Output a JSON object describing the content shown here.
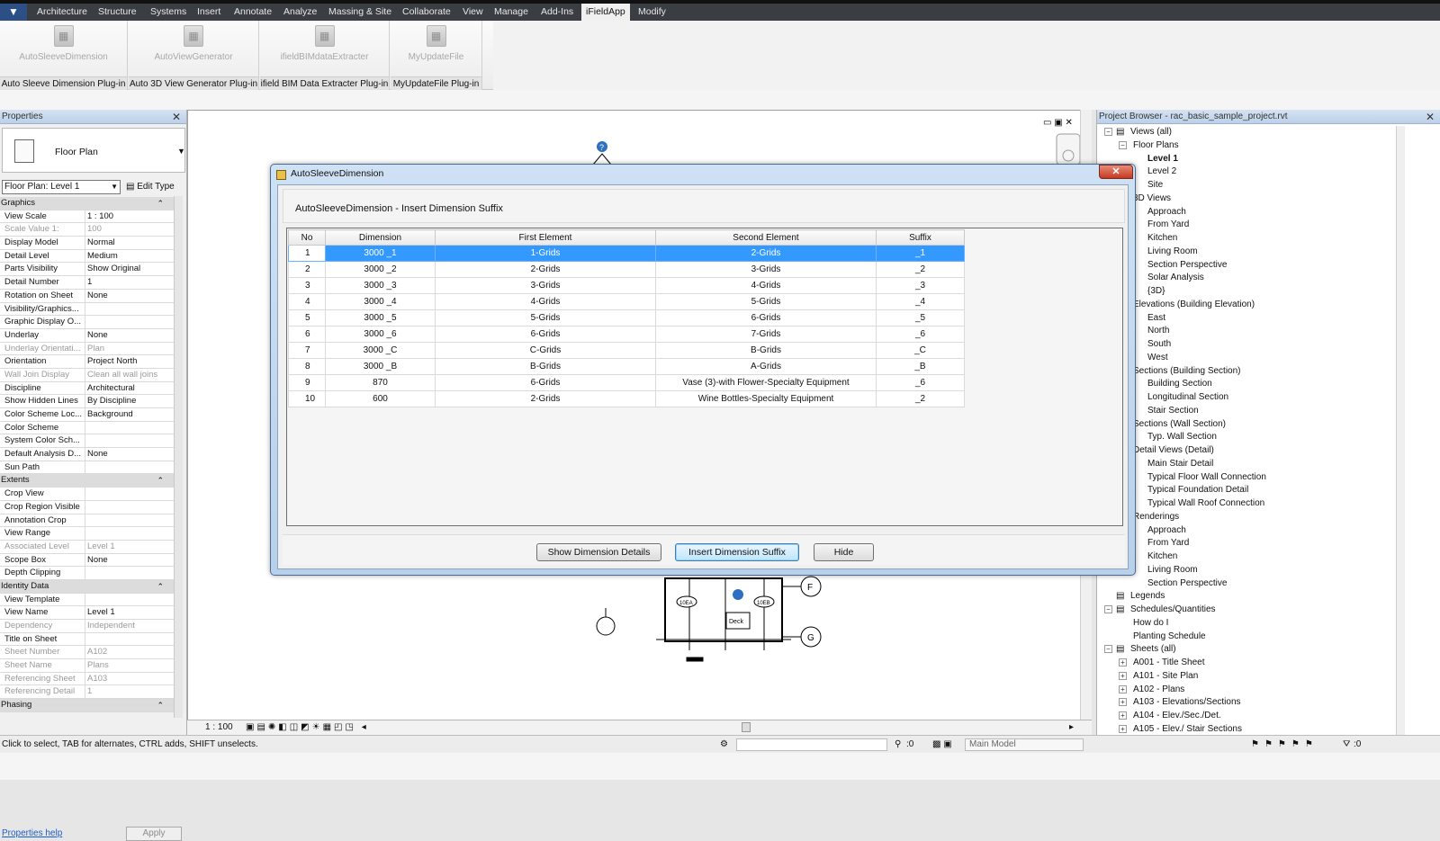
{
  "menubar": {
    "tabs": [
      "Architecture",
      "Structure",
      "Systems",
      "Insert",
      "Annotate",
      "Analyze",
      "Massing & Site",
      "Collaborate",
      "View",
      "Manage",
      "Add-Ins",
      "iFieldApp",
      "Modify"
    ],
    "active": "iFieldApp"
  },
  "ribbon": {
    "panels": [
      {
        "button": "AutoSleeveDimension",
        "title": "Auto Sleeve Dimension Plug-in"
      },
      {
        "button": "AutoViewGenerator",
        "title": "Auto 3D View Generator Plug-in"
      },
      {
        "button": "ifieldBIMdataExtracter",
        "title": "ifield BIM Data Extracter Plug-in"
      },
      {
        "button": "MyUpdateFile",
        "title": "MyUpdateFile Plug-in"
      }
    ]
  },
  "properties": {
    "title": "Properties",
    "type_name": "Floor Plan",
    "instance": "Floor Plan: Level 1",
    "edit_type": "Edit Type",
    "rows": [
      {
        "group": "Graphics"
      },
      {
        "name": "View Scale",
        "value": "1 : 100"
      },
      {
        "name": "Scale Value    1:",
        "value": "100",
        "dim": true
      },
      {
        "name": "Display Model",
        "value": "Normal"
      },
      {
        "name": "Detail Level",
        "value": "Medium"
      },
      {
        "name": "Parts Visibility",
        "value": "Show Original"
      },
      {
        "name": "Detail Number",
        "value": "1"
      },
      {
        "name": "Rotation on Sheet",
        "value": "None"
      },
      {
        "name": "Visibility/Graphics...",
        "button": "Edit..."
      },
      {
        "name": "Graphic Display O...",
        "button": "Edit..."
      },
      {
        "name": "Underlay",
        "value": "None"
      },
      {
        "name": "Underlay Orientati...",
        "value": "Plan",
        "dim": true
      },
      {
        "name": "Orientation",
        "value": "Project North"
      },
      {
        "name": "Wall Join Display",
        "value": "Clean all wall joins",
        "dim": true
      },
      {
        "name": "Discipline",
        "value": "Architectural"
      },
      {
        "name": "Show Hidden Lines",
        "value": "By Discipline"
      },
      {
        "name": "Color Scheme Loc...",
        "value": "Background"
      },
      {
        "name": "Color Scheme",
        "button": "Name"
      },
      {
        "name": "System Color Sch...",
        "button": "Edit..."
      },
      {
        "name": "Default Analysis D...",
        "value": "None"
      },
      {
        "name": "Sun Path",
        "check": "",
        "checkbox": true
      },
      {
        "group": "Extents"
      },
      {
        "name": "Crop View",
        "check": "✓",
        "checkbox": true
      },
      {
        "name": "Crop Region Visible",
        "check": "",
        "checkbox": true
      },
      {
        "name": "Annotation Crop",
        "check": "",
        "checkbox": true
      },
      {
        "name": "View Range",
        "button": "Edit..."
      },
      {
        "name": "Associated Level",
        "value": "Level 1",
        "dim": true
      },
      {
        "name": "Scope Box",
        "value": "None"
      },
      {
        "name": "Depth Clipping",
        "button": "No clip"
      },
      {
        "group": "Identity Data"
      },
      {
        "name": "View Template",
        "button": "<None>"
      },
      {
        "name": "View Name",
        "value": "Level 1"
      },
      {
        "name": "Dependency",
        "value": "Independent",
        "dim": true
      },
      {
        "name": "Title on Sheet",
        "value": ""
      },
      {
        "name": "Sheet Number",
        "value": "A102",
        "dim": true
      },
      {
        "name": "Sheet Name",
        "value": "Plans",
        "dim": true
      },
      {
        "name": "Referencing Sheet",
        "value": "A103",
        "dim": true
      },
      {
        "name": "Referencing Detail",
        "value": "1",
        "dim": true
      },
      {
        "group": "Phasing"
      }
    ],
    "help": "Properties help",
    "apply": "Apply"
  },
  "view_control": {
    "scale": "1 : 100"
  },
  "canvas": {
    "tags": [
      "F",
      "G"
    ],
    "deck": "Deck",
    "tag_a": "10EA",
    "tag_b": "10EB"
  },
  "browser": {
    "title": "Project Browser - rac_basic_sample_project.rvt",
    "nodes": [
      {
        "t": "Views (all)",
        "x": 37,
        "box": "−",
        "icon": true
      },
      {
        "t": "Floor Plans",
        "x": 40,
        "box": "−"
      },
      {
        "t": "Level 1",
        "x": 56,
        "bold": true
      },
      {
        "t": "Level 2",
        "x": 56
      },
      {
        "t": "Site",
        "x": 56
      },
      {
        "t": "3D Views",
        "x": 40
      },
      {
        "t": "Approach",
        "x": 56
      },
      {
        "t": "From Yard",
        "x": 56
      },
      {
        "t": "Kitchen",
        "x": 56
      },
      {
        "t": "Living Room",
        "x": 56
      },
      {
        "t": "Section Perspective",
        "x": 56
      },
      {
        "t": "Solar Analysis",
        "x": 56
      },
      {
        "t": "{3D}",
        "x": 56
      },
      {
        "t": "Elevations (Building Elevation)",
        "x": 40
      },
      {
        "t": "East",
        "x": 56
      },
      {
        "t": "North",
        "x": 56
      },
      {
        "t": "South",
        "x": 56
      },
      {
        "t": "West",
        "x": 56
      },
      {
        "t": "Sections (Building Section)",
        "x": 40
      },
      {
        "t": "Building Section",
        "x": 56
      },
      {
        "t": "Longitudinal Section",
        "x": 56
      },
      {
        "t": "Stair Section",
        "x": 56
      },
      {
        "t": "Sections (Wall Section)",
        "x": 40
      },
      {
        "t": "Typ. Wall Section",
        "x": 56
      },
      {
        "t": "Detail Views (Detail)",
        "x": 40
      },
      {
        "t": "Main Stair Detail",
        "x": 56
      },
      {
        "t": "Typical Floor Wall Connection",
        "x": 56
      },
      {
        "t": "Typical Foundation Detail",
        "x": 56
      },
      {
        "t": "Typical Wall Roof Connection",
        "x": 56
      },
      {
        "t": "Renderings",
        "x": 40
      },
      {
        "t": "Approach",
        "x": 56
      },
      {
        "t": "From Yard",
        "x": 56
      },
      {
        "t": "Kitchen",
        "x": 56
      },
      {
        "t": "Living Room",
        "x": 56
      },
      {
        "t": "Section Perspective",
        "x": 56
      },
      {
        "t": "Legends",
        "x": 37,
        "icon": true
      },
      {
        "t": "Schedules/Quantities",
        "x": 37,
        "box": "−",
        "icon": true
      },
      {
        "t": "How do I",
        "x": 40
      },
      {
        "t": "Planting Schedule",
        "x": 40
      },
      {
        "t": "Sheets (all)",
        "x": 37,
        "box": "−",
        "icon": true
      },
      {
        "t": "A001 - Title Sheet",
        "x": 40,
        "box": "+"
      },
      {
        "t": "A101 - Site Plan",
        "x": 40,
        "box": "+"
      },
      {
        "t": "A102 - Plans",
        "x": 40,
        "box": "+"
      },
      {
        "t": "A103 - Elevations/Sections",
        "x": 40,
        "box": "+"
      },
      {
        "t": "A104 - Elev./Sec./Det.",
        "x": 40,
        "box": "+"
      },
      {
        "t": "A105 - Elev./ Stair Sections",
        "x": 40,
        "box": "+"
      }
    ]
  },
  "status": {
    "hint": "Click to select, TAB for alternates, CTRL adds, SHIFT unselects.",
    "selected_count": ":0",
    "model": "Main Model",
    "filter_count": ":0"
  },
  "dialog": {
    "title": "AutoSleeveDimension",
    "heading": "AutoSleeveDimension - Insert Dimension Suffix",
    "columns": [
      "No",
      "Dimension",
      "First Element",
      "Second Element",
      "Suffix"
    ],
    "rows": [
      {
        "no": "1",
        "dimension": "3000 _1",
        "first": "1-Grids",
        "second": "2-Grids",
        "suffix": "_1",
        "selected": true
      },
      {
        "no": "2",
        "dimension": "3000 _2",
        "first": "2-Grids",
        "second": "3-Grids",
        "suffix": "_2"
      },
      {
        "no": "3",
        "dimension": "3000 _3",
        "first": "3-Grids",
        "second": "4-Grids",
        "suffix": "_3"
      },
      {
        "no": "4",
        "dimension": "3000 _4",
        "first": "4-Grids",
        "second": "5-Grids",
        "suffix": "_4"
      },
      {
        "no": "5",
        "dimension": "3000 _5",
        "first": "5-Grids",
        "second": "6-Grids",
        "suffix": "_5"
      },
      {
        "no": "6",
        "dimension": "3000 _6",
        "first": "6-Grids",
        "second": "7-Grids",
        "suffix": "_6"
      },
      {
        "no": "7",
        "dimension": "3000 _C",
        "first": "C-Grids",
        "second": "B-Grids",
        "suffix": "_C"
      },
      {
        "no": "8",
        "dimension": "3000 _B",
        "first": "B-Grids",
        "second": "A-Grids",
        "suffix": "_B"
      },
      {
        "no": "9",
        "dimension": "870",
        "first": "6-Grids",
        "second": "Vase (3)-with Flower-Specialty Equipment",
        "suffix": "_6"
      },
      {
        "no": "10",
        "dimension": "600",
        "first": "2-Grids",
        "second": "Wine Bottles-Specialty Equipment",
        "suffix": "_2"
      }
    ],
    "buttons": {
      "details": "Show Dimension Details",
      "insert": "Insert Dimension Suffix",
      "hide": "Hide"
    }
  }
}
